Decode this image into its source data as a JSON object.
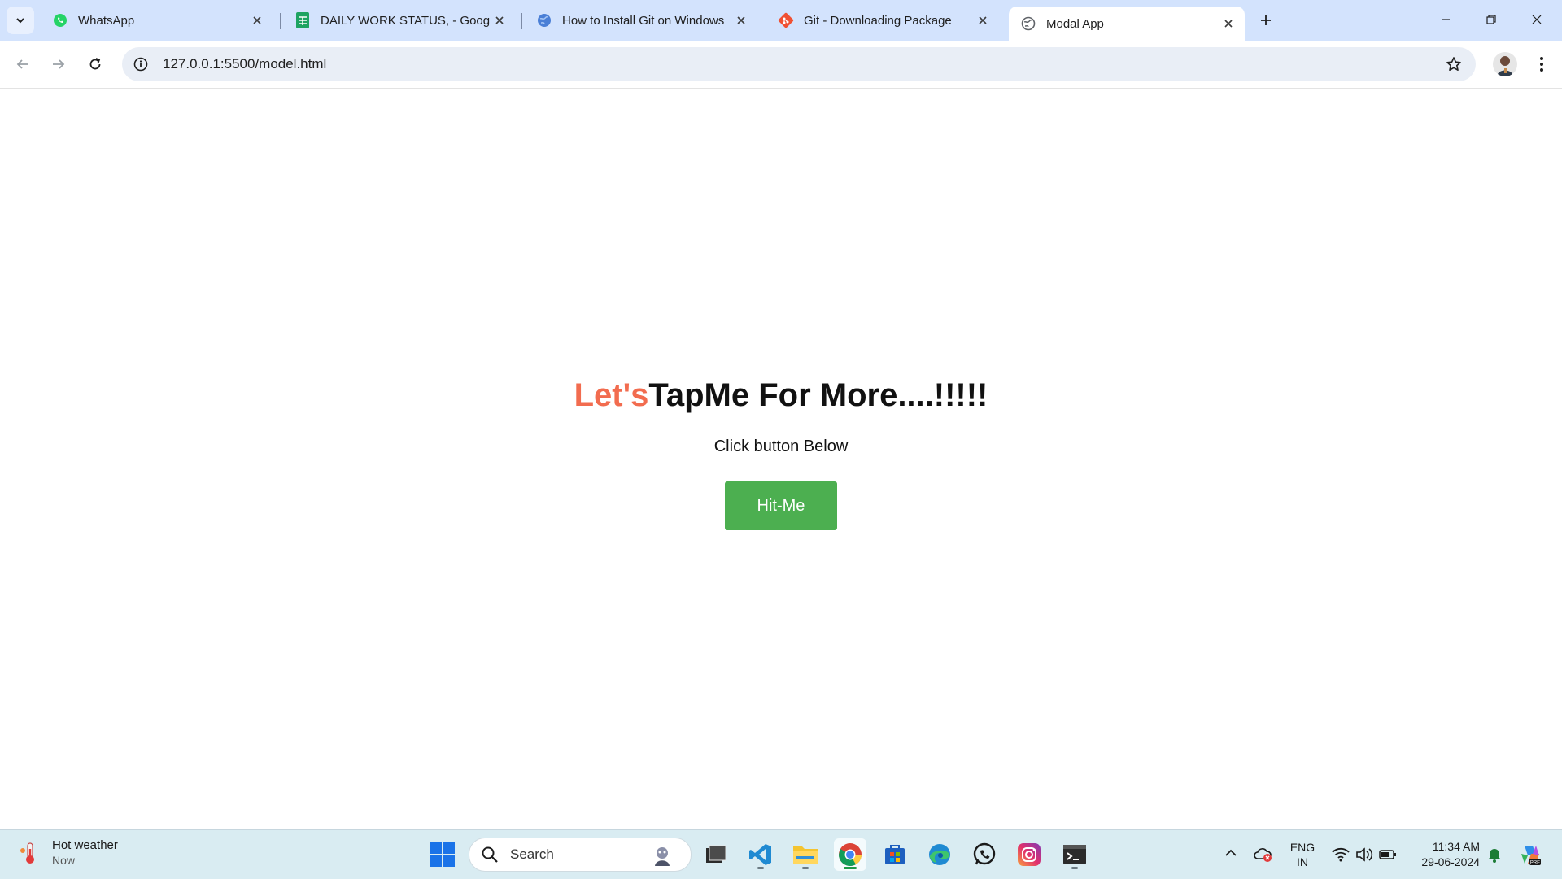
{
  "browser": {
    "tabs": [
      {
        "title": "WhatsApp",
        "icon": "whatsapp-icon",
        "active": false
      },
      {
        "title": "DAILY WORK STATUS, - Google",
        "icon": "google-sheets-icon",
        "active": false
      },
      {
        "title": "How to Install Git on Windows",
        "icon": "globe-icon",
        "active": false
      },
      {
        "title": "Git - Downloading Package",
        "icon": "git-icon",
        "active": false
      },
      {
        "title": "Modal App",
        "icon": "globe-icon",
        "active": true
      }
    ],
    "url": "127.0.0.1:5500/model.html"
  },
  "page": {
    "heading_accent": "Let's",
    "heading_rest": "TapMe For More....!!!!!",
    "subtext": "Click button Below",
    "button_label": "Hit-Me",
    "accent_color": "#f26c4f",
    "button_color": "#4caf50"
  },
  "taskbar": {
    "weather_title": "Hot weather",
    "weather_sub": "Now",
    "search_label": "Search",
    "apps": [
      "file-explorer-stack-icon",
      "vscode-icon",
      "folder-icon",
      "chrome-icon",
      "store-icon",
      "edge-icon",
      "whatsapp-icon",
      "instagram-icon",
      "terminal-icon"
    ],
    "lang_top": "ENG",
    "lang_bottom": "IN",
    "time": "11:34 AM",
    "date": "29-06-2024"
  }
}
